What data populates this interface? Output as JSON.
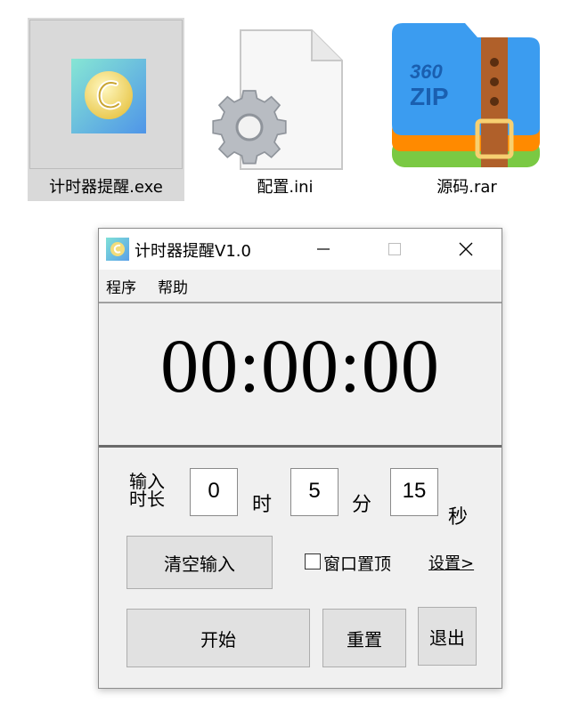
{
  "desktop": {
    "files": [
      {
        "name": "计时器提醒.exe",
        "icon": "clock-app-icon",
        "selected": true
      },
      {
        "name": "配置.ini",
        "icon": "settings-file-icon",
        "selected": false
      },
      {
        "name": "源码.rar",
        "icon": "360zip-archive-icon",
        "selected": false
      }
    ],
    "zip_logo_line1": "360",
    "zip_logo_line2": "ZIP"
  },
  "window": {
    "title": "计时器提醒V1.0",
    "menu": [
      "程序",
      "帮助"
    ],
    "time_display": "00:00:00",
    "input_label": "输入\n时长",
    "hours": {
      "value": "0",
      "unit": "时"
    },
    "minutes": {
      "value": "5",
      "unit": "分"
    },
    "seconds": {
      "value": "15",
      "unit": "秒"
    },
    "clear_button": "清空输入",
    "topmost_label": "窗口置顶",
    "topmost_checked": false,
    "settings_link": "设置>",
    "start_button": "开始",
    "reset_button": "重置",
    "exit_button": "退出"
  },
  "colors": {
    "selection": "#d9d9d9",
    "window_bg": "#f0f0f0",
    "button_bg": "#e1e1e1",
    "zip_blue": "#3b9cf0",
    "zip_orange": "#ff8a00",
    "zip_green": "#7ac943",
    "zip_strap": "#b0602a"
  }
}
